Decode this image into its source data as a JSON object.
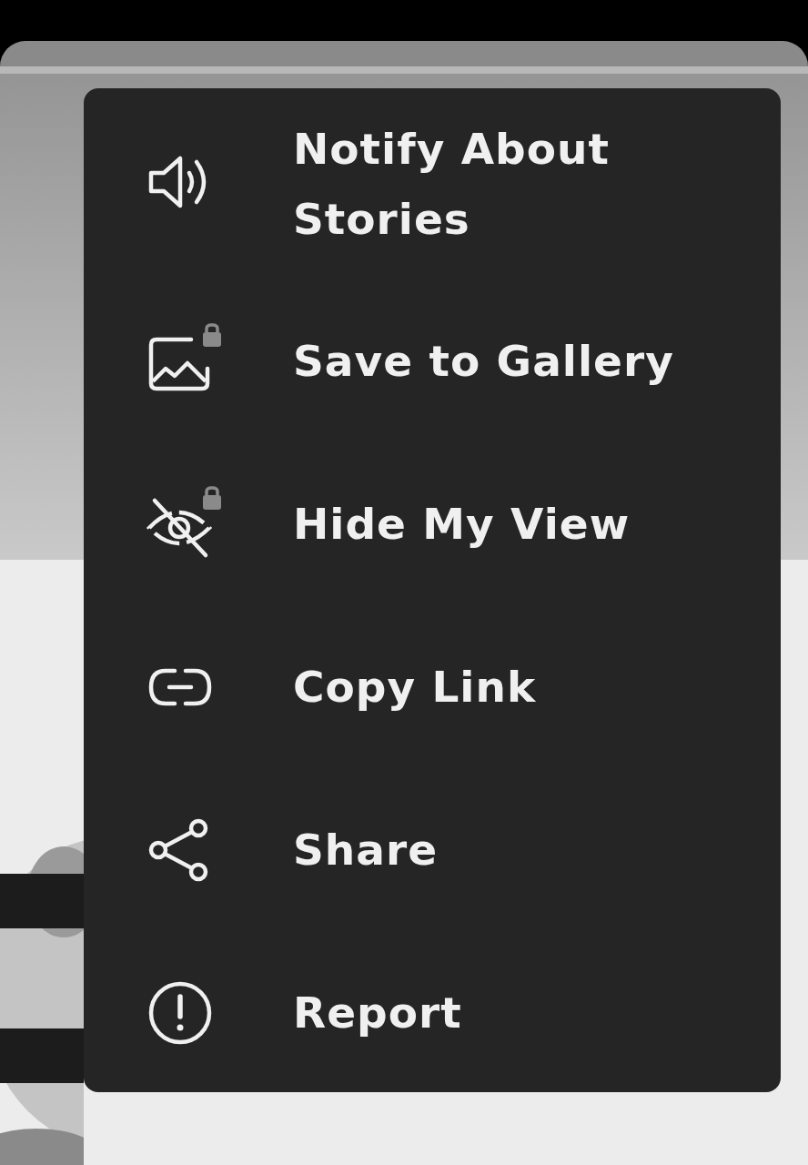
{
  "menu": {
    "items": [
      {
        "kind": "notify",
        "label": "Notify About Stories",
        "locked": false
      },
      {
        "kind": "save",
        "label": "Save to Gallery",
        "locked": true
      },
      {
        "kind": "hide",
        "label": "Hide My View",
        "locked": true
      },
      {
        "kind": "link",
        "label": "Copy Link",
        "locked": false
      },
      {
        "kind": "share",
        "label": "Share",
        "locked": false
      },
      {
        "kind": "report",
        "label": "Report",
        "locked": false
      }
    ]
  }
}
